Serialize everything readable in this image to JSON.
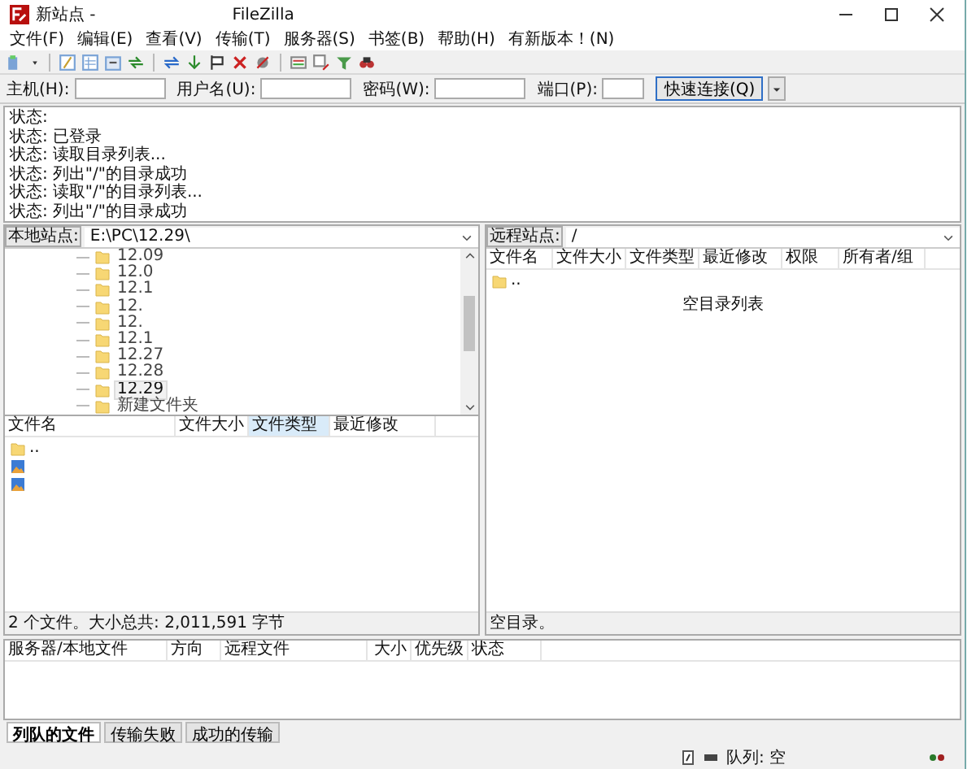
{
  "window": {
    "title": "新站点 -",
    "app": "FileZilla"
  },
  "menu": [
    "文件(F)",
    "编辑(E)",
    "查看(V)",
    "传输(T)",
    "服务器(S)",
    "书签(B)",
    "帮助(H)",
    "有新版本！(N)"
  ],
  "quickconnect": {
    "fields": [
      {
        "label": "主机(H):"
      },
      {
        "label": "用户名(U):"
      },
      {
        "label": "密码(W):"
      },
      {
        "label": "端口(P):"
      }
    ],
    "button": "快速连接(Q)"
  },
  "log": [
    {
      "label": "状态:"
    },
    {
      "label": "状态:",
      "message": "已登录"
    },
    {
      "label": "状态:",
      "message": "读取目录列表..."
    },
    {
      "label": "状态:",
      "message": "列出\"/\"的目录成功"
    },
    {
      "label": "状态:",
      "message": "读取\"/\"的目录列表..."
    },
    {
      "label": "状态:",
      "message": "列出\"/\"的目录成功"
    }
  ],
  "local": {
    "label": "本地站点:",
    "path": "E:\\PC\\12.29\\",
    "tree": [
      {
        "name": "12.09",
        "selected": false
      },
      {
        "name": "12.0",
        "selected": false
      },
      {
        "name": "12.1",
        "selected": false
      },
      {
        "name": "12.",
        "selected": false
      },
      {
        "name": "12.",
        "selected": false
      },
      {
        "name": "12.1",
        "selected": false
      },
      {
        "name": "12.27",
        "selected": false
      },
      {
        "name": "12.28",
        "selected": false
      },
      {
        "name": "12.29",
        "selected": true
      },
      {
        "name": "新建文件夹",
        "selected": false
      }
    ],
    "columns": [
      {
        "label": "文件名",
        "sorted": false
      },
      {
        "label": "文件大小",
        "sorted": false
      },
      {
        "label": "文件类型",
        "sorted": true
      },
      {
        "label": "最近修改",
        "sorted": false
      }
    ],
    "rows": [
      {
        "kind": "folder",
        "name": ".."
      },
      {
        "kind": "image"
      },
      {
        "kind": "image"
      }
    ],
    "status": "2 个文件。大小总共: 2,011,591 字节"
  },
  "remote": {
    "label": "远程站点:",
    "path": "/",
    "columns": [
      {
        "label": "文件名",
        "sorted": false
      },
      {
        "label": "文件大小",
        "sorted": false
      },
      {
        "label": "文件类型",
        "sorted": false
      },
      {
        "label": "最近修改",
        "sorted": false
      },
      {
        "label": "权限",
        "sorted": false
      },
      {
        "label": "所有者/组",
        "sorted": false
      }
    ],
    "rows": [
      {
        "kind": "folder",
        "name": ".."
      }
    ],
    "empty_message": "空目录列表",
    "status": "空目录。"
  },
  "queue": {
    "columns": [
      "服务器/本地文件",
      "方向",
      "远程文件",
      "大小",
      "优先级",
      "状态"
    ],
    "tabs": [
      {
        "label": "列队的文件",
        "selected": true
      },
      {
        "label": "传输失败",
        "selected": false
      },
      {
        "label": "成功的传输",
        "selected": false
      }
    ]
  },
  "status_bar": {
    "queue": "队列: 空"
  }
}
